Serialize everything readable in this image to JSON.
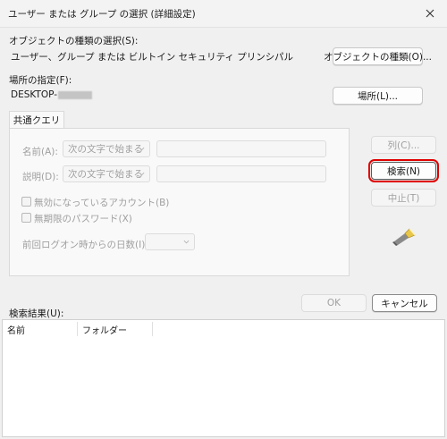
{
  "window": {
    "title": "ユーザー または グループ の選択 (詳細設定)"
  },
  "object_type": {
    "label": "オブジェクトの種類の選択(S):",
    "value": "ユーザー、グループ または ビルトイン セキュリティ プリンシパル",
    "button": "オブジェクトの種類(O)..."
  },
  "location": {
    "label": "場所の指定(F):",
    "value": "DESKTOP-",
    "button": "場所(L)..."
  },
  "tabs": [
    {
      "label": "共通クエリ"
    }
  ],
  "query": {
    "name_label": "名前(A):",
    "name_mode": "次の文字で始まる",
    "desc_label": "説明(D):",
    "desc_mode": "次の文字で始まる",
    "disabled_accounts": "無効になっているアカウント(B)",
    "no_expire_pw": "無期限のパスワード(X)",
    "days_label": "前回ログオン時からの日数(I):"
  },
  "side_buttons": {
    "columns": "列(C)...",
    "search": "検索(N)",
    "stop": "中止(T)"
  },
  "dialog_buttons": {
    "ok": "OK",
    "cancel": "キャンセル"
  },
  "results": {
    "label": "検索結果(U):",
    "columns": [
      "名前",
      "フォルダー"
    ]
  },
  "colors": {
    "highlight": "#e00000",
    "disabled": "#a0a0a0"
  }
}
